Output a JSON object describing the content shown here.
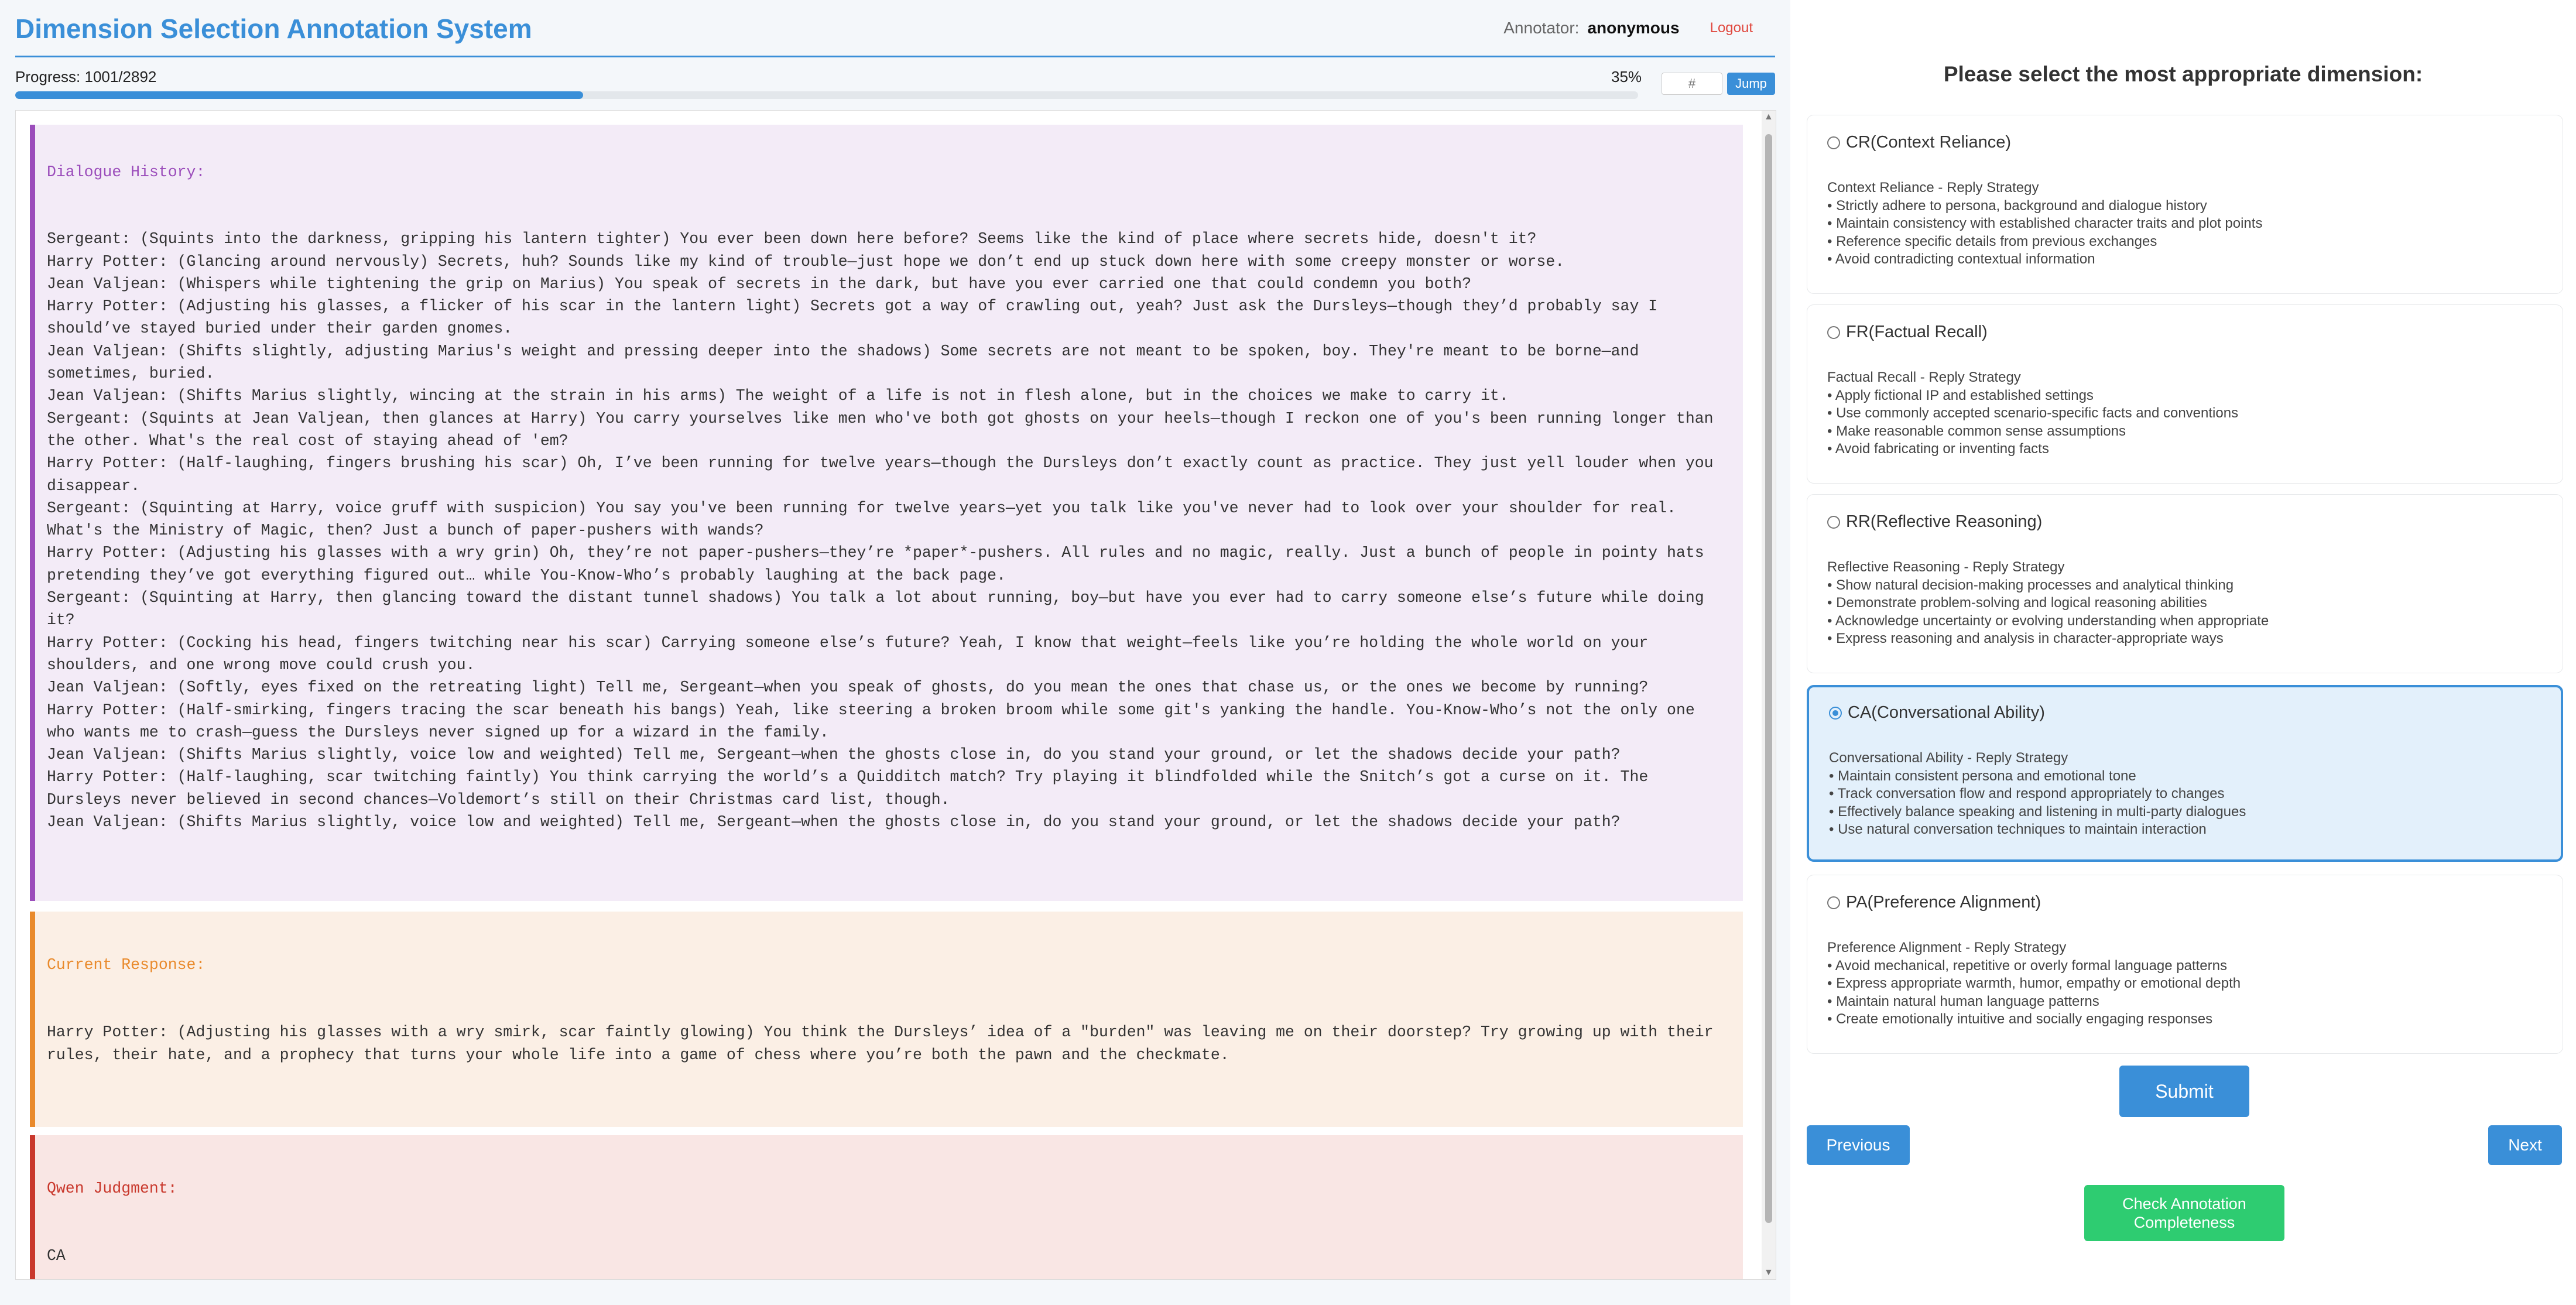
{
  "header": {
    "title": "Dimension Selection Annotation System",
    "annotator_label": "Annotator:",
    "annotator_name": "anonymous",
    "logout_label": "Logout"
  },
  "progress": {
    "label": "Progress: 1001/2892",
    "percent_text": "35%",
    "fraction": 0.35,
    "jump_placeholder": "#",
    "jump_label": "Jump"
  },
  "dialogue": {
    "heading": "Dialogue History:",
    "lines": [
      "Sergeant: (Squints into the darkness, gripping his lantern tighter) You ever been down here before? Seems like the kind of place where secrets hide, doesn't it?",
      "Harry Potter: (Glancing around nervously) Secrets, huh? Sounds like my kind of trouble—just hope we don’t end up stuck down here with some creepy monster or worse.",
      "Jean Valjean: (Whispers while tightening the grip on Marius) You speak of secrets in the dark, but have you ever carried one that could condemn you both?",
      "Harry Potter: (Adjusting his glasses, a flicker of his scar in the lantern light) Secrets got a way of crawling out, yeah? Just ask the Dursleys—though they’d probably say I should’ve stayed buried under their garden gnomes.",
      "Jean Valjean: (Shifts slightly, adjusting Marius's weight and pressing deeper into the shadows) Some secrets are not meant to be spoken, boy. They're meant to be borne—and sometimes, buried.",
      "Jean Valjean: (Shifts Marius slightly, wincing at the strain in his arms) The weight of a life is not in flesh alone, but in the choices we make to carry it.",
      "Sergeant: (Squints at Jean Valjean, then glances at Harry) You carry yourselves like men who've both got ghosts on your heels—though I reckon one of you's been running longer than the other. What's the real cost of staying ahead of 'em?",
      "Harry Potter: (Half-laughing, fingers brushing his scar) Oh, I’ve been running for twelve years—though the Dursleys don’t exactly count as practice. They just yell louder when you disappear.",
      "Sergeant: (Squinting at Harry, voice gruff with suspicion) You say you've been running for twelve years—yet you talk like you've never had to look over your shoulder for real. What's the Ministry of Magic, then? Just a bunch of paper-pushers with wands?",
      "Harry Potter: (Adjusting his glasses with a wry grin) Oh, they’re not paper-pushers—they’re *paper*-pushers. All rules and no magic, really. Just a bunch of people in pointy hats pretending they’ve got everything figured out… while You-Know-Who’s probably laughing at the back page.",
      "Sergeant: (Squinting at Harry, then glancing toward the distant tunnel shadows) You talk a lot about running, boy—but have you ever had to carry someone else’s future while doing it?",
      "Harry Potter: (Cocking his head, fingers twitching near his scar) Carrying someone else’s future? Yeah, I know that weight—feels like you’re holding the whole world on your shoulders, and one wrong move could crush you.",
      "Jean Valjean: (Softly, eyes fixed on the retreating light) Tell me, Sergeant—when you speak of ghosts, do you mean the ones that chase us, or the ones we become by running?",
      "Harry Potter: (Half-smirking, fingers tracing the scar beneath his bangs) Yeah, like steering a broken broom while some git's yanking the handle. You-Know-Who’s not the only one who wants me to crash—guess the Dursleys never signed up for a wizard in the family.",
      "Jean Valjean: (Shifts Marius slightly, voice low and weighted) Tell me, Sergeant—when the ghosts close in, do you stand your ground, or let the shadows decide your path?",
      "Harry Potter: (Half-laughing, scar twitching faintly) You think carrying the world’s a Quidditch match? Try playing it blindfolded while the Snitch’s got a curse on it. The Dursleys never believed in second chances—Voldemort’s still on their Christmas card list, though.",
      "Jean Valjean: (Shifts Marius slightly, voice low and weighted) Tell me, Sergeant—when the ghosts close in, do you stand your ground, or let the shadows decide your path?"
    ]
  },
  "response": {
    "heading": "Current Response:",
    "text": "Harry Potter: (Adjusting his glasses with a wry smirk, scar faintly glowing) You think the Dursleys’ idea of a \"burden\" was leaving me on their doorstep? Try growing up with their rules, their hate, and a prophecy that turns your whole life into a game of chess where you’re both the pawn and the checkmate."
  },
  "judgment": {
    "heading": "Qwen Judgment:",
    "text": "CA"
  },
  "panel": {
    "heading": "Please select the most appropriate dimension:",
    "selected": "CA",
    "options": [
      {
        "code": "CR",
        "title": "CR(Context Reliance)",
        "subtitle": "Context Reliance - Reply Strategy",
        "bullets": [
          "• Strictly adhere to persona, background and dialogue history",
          "• Maintain consistency with established character traits and plot points",
          "• Reference specific details from previous exchanges",
          "• Avoid contradicting contextual information"
        ]
      },
      {
        "code": "FR",
        "title": "FR(Factual Recall)",
        "subtitle": "Factual Recall - Reply Strategy",
        "bullets": [
          "• Apply fictional IP and established settings",
          "• Use commonly accepted scenario-specific facts and conventions",
          "• Make reasonable common sense assumptions",
          "• Avoid fabricating or inventing facts"
        ]
      },
      {
        "code": "RR",
        "title": "RR(Reflective Reasoning)",
        "subtitle": "Reflective Reasoning - Reply Strategy",
        "bullets": [
          "• Show natural decision-making processes and analytical thinking",
          "• Demonstrate problem-solving and logical reasoning abilities",
          "• Acknowledge uncertainty or evolving understanding when appropriate",
          "• Express reasoning and analysis in character-appropriate ways"
        ]
      },
      {
        "code": "CA",
        "title": "CA(Conversational Ability)",
        "subtitle": "Conversational Ability - Reply Strategy",
        "bullets": [
          "• Maintain consistent persona and emotional tone",
          "• Track conversation flow and respond appropriately to changes",
          "• Effectively balance speaking and listening in multi-party dialogues",
          "• Use natural conversation techniques to maintain interaction"
        ]
      },
      {
        "code": "PA",
        "title": "PA(Preference Alignment)",
        "subtitle": "Preference Alignment - Reply Strategy",
        "bullets": [
          "• Avoid mechanical, repetitive or overly formal language patterns",
          "• Express appropriate warmth, humor, empathy or emotional depth",
          "• Maintain natural human language patterns",
          "• Create emotionally intuitive and socially engaging responses"
        ]
      }
    ],
    "submit_label": "Submit",
    "previous_label": "Previous",
    "next_label": "Next",
    "check_label": "Check Annotation Completeness"
  },
  "colors": {
    "accent": "#3a8fd8",
    "dialogue_border": "#9b4dbb",
    "response_border": "#e98a2c",
    "judgment_border": "#c9382c",
    "check_button": "#2ecc71",
    "logout": "#e0483e"
  }
}
